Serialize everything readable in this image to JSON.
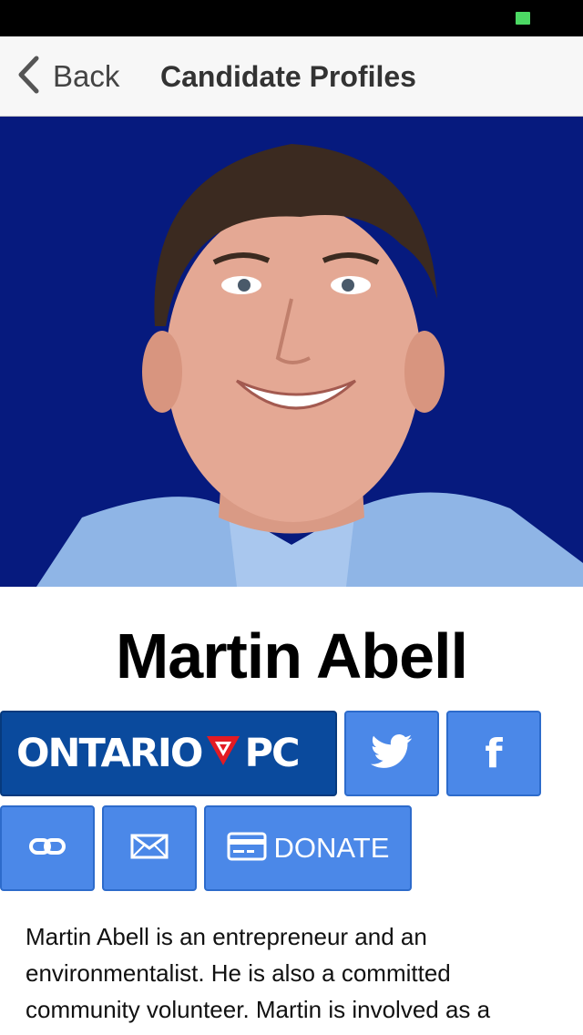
{
  "nav": {
    "back_label": "Back",
    "title": "Candidate Profiles"
  },
  "candidate": {
    "name": "Martin Abell",
    "party_logo_text_left": "ONTARIO",
    "party_logo_text_right": "PC",
    "bio": "Martin Abell is an entrepreneur and an environmentalist. He is also a committed community volunteer. Martin is involved as a"
  },
  "buttons": {
    "donate_label": "DONATE"
  },
  "icons": {
    "back": "chevron-left-icon",
    "twitter": "twitter-bird-icon",
    "facebook": "facebook-f-icon",
    "link": "link-chain-icon",
    "email": "envelope-icon",
    "donate": "credit-card-icon",
    "party": "trillium-icon"
  },
  "colors": {
    "button_blue": "#4b88e8",
    "party_blue": "#0a4a9d",
    "photo_background": "#061a7e",
    "trillium_red": "#e31b23",
    "battery_green": "#4cd964"
  }
}
